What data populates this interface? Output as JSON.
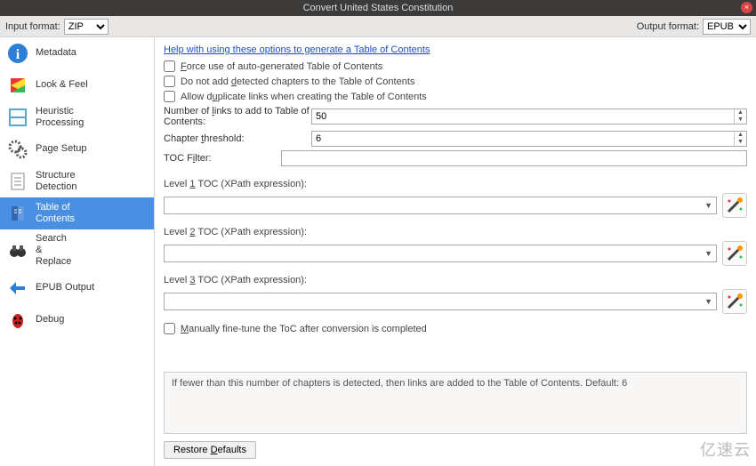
{
  "window": {
    "title": "Convert United States Constitution"
  },
  "formats": {
    "input_label": "Input format:",
    "input_value": "ZIP",
    "output_label": "Output format:",
    "output_value": "EPUB"
  },
  "sidebar": {
    "items": [
      {
        "label": "Metadata"
      },
      {
        "label": "Look & Feel"
      },
      {
        "label": "Heuristic\nProcessing"
      },
      {
        "label": "Page Setup"
      },
      {
        "label": "Structure\nDetection"
      },
      {
        "label": "Table of\nContents"
      },
      {
        "label": "Search\n&\nReplace"
      },
      {
        "label": "EPUB Output"
      },
      {
        "label": "Debug"
      }
    ],
    "selected_index": 5
  },
  "toc": {
    "help_link": "Help with using these options to generate a Table of Contents",
    "force_label": "Force use of auto-generated Table of Contents",
    "no_add_label": "Do not add detected chapters to the Table of Contents",
    "allow_dup_label": "Allow duplicate links when creating the Table of Contents",
    "num_links_label": "Number of links to add to Table of Contents:",
    "num_links_value": "50",
    "threshold_label": "Chapter threshold:",
    "threshold_value": "6",
    "filter_label": "TOC Filter:",
    "filter_value": "",
    "levels": [
      {
        "label": "Level 1 TOC (XPath expression):",
        "value": ""
      },
      {
        "label": "Level 2 TOC (XPath expression):",
        "value": ""
      },
      {
        "label": "Level 3 TOC (XPath expression):",
        "value": ""
      }
    ],
    "manual_label": "Manually fine-tune the ToC after conversion is completed",
    "hint": "If fewer than this number of chapters is detected, then links are added to the Table of Contents. Default: 6"
  },
  "buttons": {
    "restore": "Restore Defaults"
  },
  "watermark": "亿速云"
}
